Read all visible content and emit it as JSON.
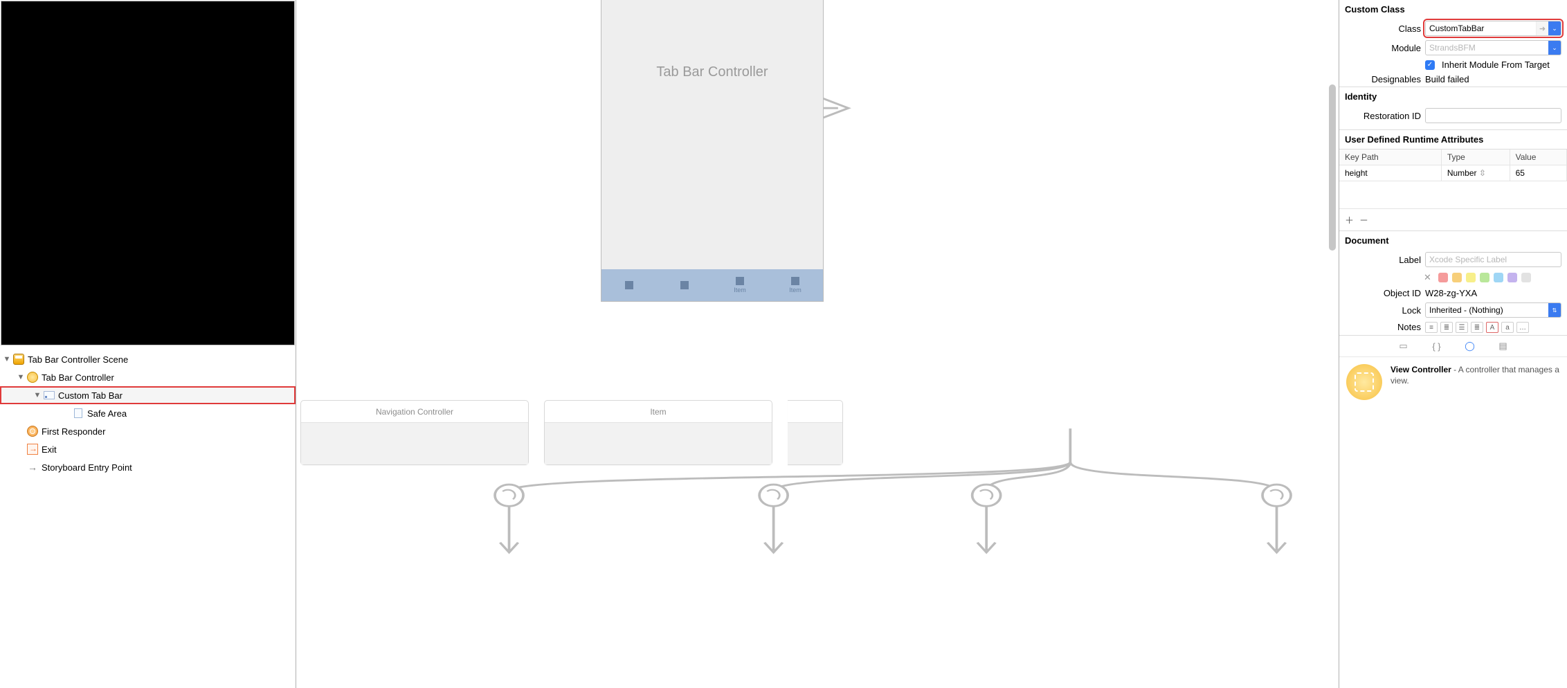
{
  "left": {
    "scene": "Tab Bar Controller Scene",
    "tbc": "Tab Bar Controller",
    "ctb": "Custom Tab Bar",
    "safe": "Safe Area",
    "fr": "First Responder",
    "exit": "Exit",
    "entry": "Storyboard Entry Point"
  },
  "canvas": {
    "phone_title": "Tab Bar Controller",
    "tab3": "Item",
    "tab4": "Item",
    "card1": "Navigation Controller",
    "card2": "Item"
  },
  "inspector": {
    "custom_class_title": "Custom Class",
    "class_label": "Class",
    "class_value": "CustomTabBar",
    "module_label": "Module",
    "module_placeholder": "StrandsBFM",
    "inherit_label": "Inherit Module From Target",
    "designables_label": "Designables",
    "designables_value": "Build failed",
    "identity_title": "Identity",
    "restoration_label": "Restoration ID",
    "udra_title": "User Defined Runtime Attributes",
    "udra_h_kp": "Key Path",
    "udra_h_ty": "Type",
    "udra_h_vl": "Value",
    "udra_r_kp": "height",
    "udra_r_ty": "Number",
    "udra_r_vl": "65",
    "document_title": "Document",
    "label_label": "Label",
    "label_placeholder": "Xcode Specific Label",
    "objectid_label": "Object ID",
    "objectid_value": "W28-zg-YXA",
    "lock_label": "Lock",
    "lock_value": "Inherited - (Nothing)",
    "notes_label": "Notes",
    "swatch_colors": [
      "#f59b9b",
      "#f7cf7a",
      "#f7ef8a",
      "#b9e79a",
      "#9fd6f5",
      "#c4b3ee",
      "#e2e2e2"
    ],
    "lib_title": "View Controller",
    "lib_desc": " - A controller that manages a view."
  }
}
